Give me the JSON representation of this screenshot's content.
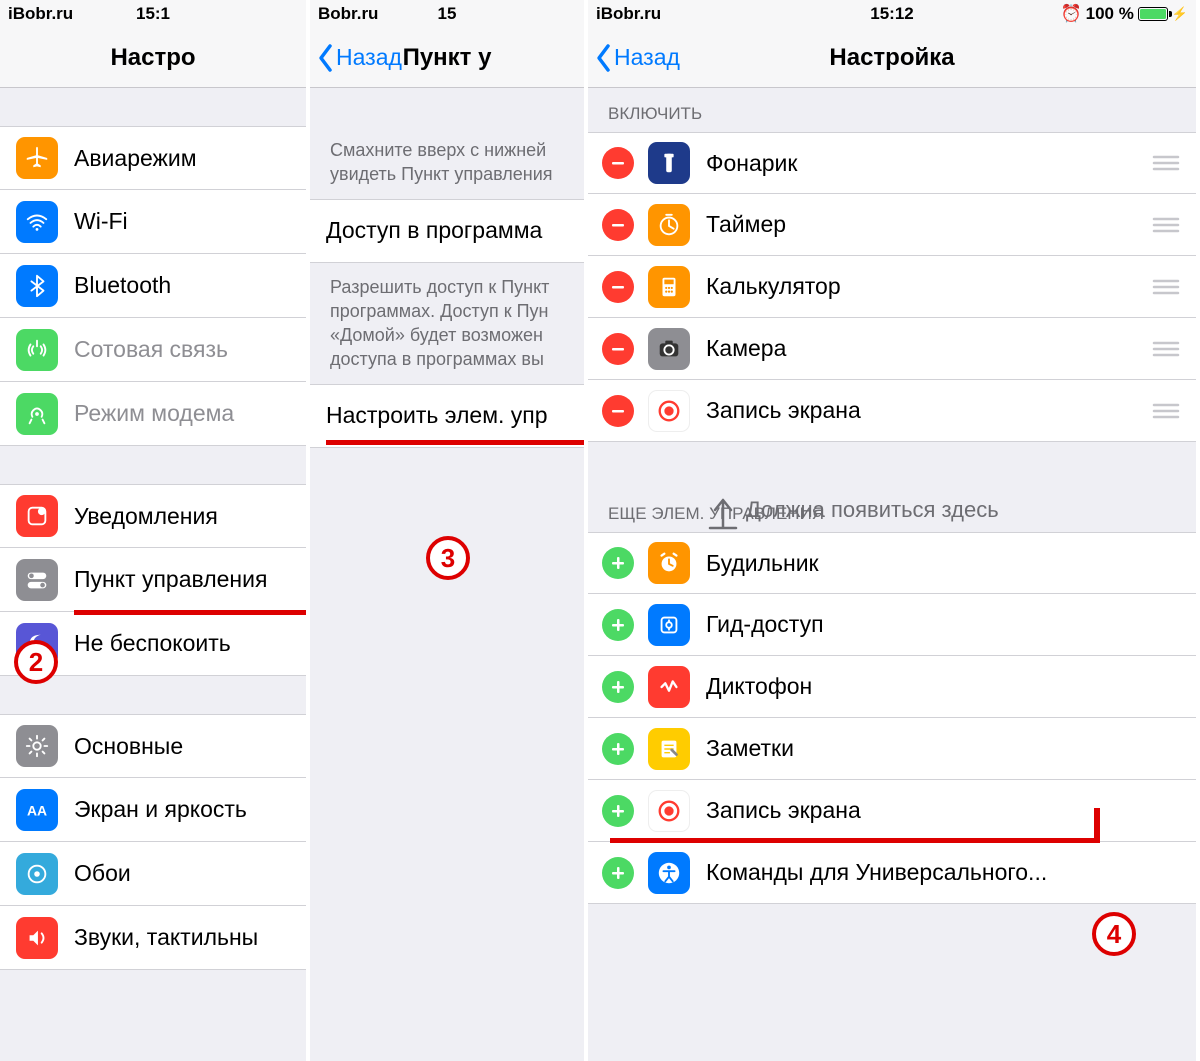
{
  "p1": {
    "status_left": "iBobr.ru",
    "status_time": "15:1",
    "title": "Настро",
    "items": [
      {
        "label": "Авиарежим",
        "icon": "airplane",
        "color": "orange"
      },
      {
        "label": "Wi-Fi",
        "icon": "wifi",
        "color": "blue"
      },
      {
        "label": "Bluetooth",
        "icon": "bluetooth",
        "color": "blue"
      },
      {
        "label": "Сотовая связь",
        "icon": "cellular",
        "color": "green",
        "dim": true
      },
      {
        "label": "Режим модема",
        "icon": "hotspot",
        "color": "greenlink",
        "dim": true
      }
    ],
    "items2": [
      {
        "label": "Уведомления",
        "icon": "notifications",
        "color": "red"
      },
      {
        "label": "Пункт управления",
        "icon": "toggles",
        "color": "grayctl"
      },
      {
        "label": "Не беспокоить",
        "icon": "moon",
        "color": "moon"
      }
    ],
    "items3": [
      {
        "label": "Основные",
        "icon": "gear",
        "color": "gray"
      },
      {
        "label": "Экран и яркость",
        "icon": "display",
        "color": "darkblue"
      },
      {
        "label": "Обои",
        "icon": "wallpaper",
        "color": "teal"
      },
      {
        "label": "Звуки, тактильны",
        "icon": "sound",
        "color": "redsound"
      }
    ],
    "badge": "2"
  },
  "p2": {
    "status_left": "Bobr.ru",
    "status_time": "15",
    "back": "Назад",
    "title": "Пункт у",
    "desc1": "Смахните вверх с нижней увидеть Пункт управления",
    "row": "Доступ в программа",
    "desc2": "Разрешить доступ к Пункт программах. Доступ к Пун «Домой» будет возможен доступа в программах вы",
    "row2": "Настроить элем. упр",
    "badge": "3"
  },
  "p3": {
    "status_left": "iBobr.ru",
    "status_time": "15:12",
    "status_batt": "100 %",
    "back": "Назад",
    "title": "Настройка",
    "section_include": "ВКЛЮЧИТЬ",
    "included": [
      {
        "label": "Фонарик",
        "icon": "flashlight",
        "color": "navy"
      },
      {
        "label": "Таймер",
        "icon": "timer",
        "color": "orange"
      },
      {
        "label": "Калькулятор",
        "icon": "calculator",
        "color": "orange"
      },
      {
        "label": "Камера",
        "icon": "camera",
        "color": "graycam"
      },
      {
        "label": "Запись экрана",
        "icon": "record",
        "color": "odored"
      }
    ],
    "note": "Должна появиться здесь",
    "section_more": "ЕЩЕ ЭЛЕМ. УПРАВЛЕНИЯ",
    "more": [
      {
        "label": "Будильник",
        "icon": "alarm",
        "color": "orange"
      },
      {
        "label": "Гид-доступ",
        "icon": "guided",
        "color": "blue"
      },
      {
        "label": "Диктофон",
        "icon": "voice",
        "color": "red"
      },
      {
        "label": "Заметки",
        "icon": "notes",
        "color": "yellow"
      },
      {
        "label": "Запись экрана",
        "icon": "record",
        "color": "odored"
      },
      {
        "label": "Команды для Универсального...",
        "icon": "accessibility",
        "color": "blue"
      }
    ],
    "badge": "4"
  }
}
